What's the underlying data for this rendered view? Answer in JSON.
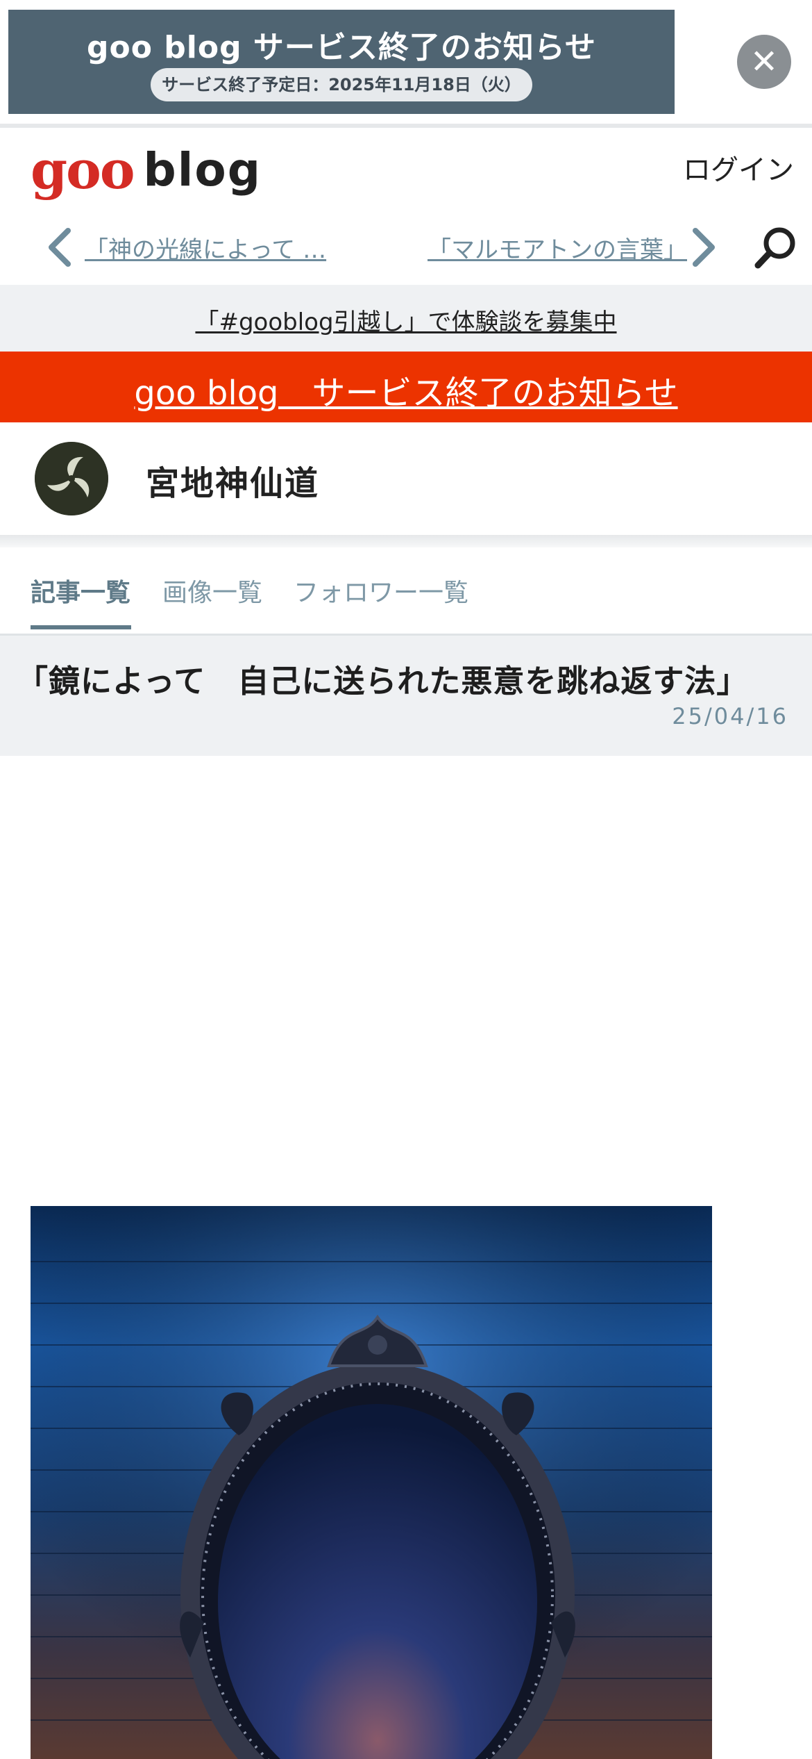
{
  "banner": {
    "title": "goo blog サービス終了のお知らせ",
    "date_pill": "サービス終了予定日：2025年11月18日（火）"
  },
  "close_icon": "close-icon",
  "header": {
    "logo_goo": "goo",
    "logo_blog": "blog",
    "login_label": "ログイン"
  },
  "article_nav": {
    "prev_label": "「神の光線によって …",
    "next_label": "「マルモアトンの言葉」"
  },
  "campaign": {
    "text": "「#gooblog引越し」で体験談を募集中"
  },
  "notice": {
    "text": "goo blog　サービス終了のお知らせ"
  },
  "blog": {
    "name": "宮地神仙道"
  },
  "tabs": [
    {
      "label": "記事一覧",
      "active": true
    },
    {
      "label": "画像一覧",
      "active": false
    },
    {
      "label": "フォロワー一覧",
      "active": false
    }
  ],
  "article": {
    "title": "「鏡によって　自己に送られた悪意を跳ね返す法」",
    "date": "25/04/16"
  },
  "colors": {
    "banner_bg": "#4f6472",
    "notice_red": "#ec3300",
    "logo_red": "#d42b24",
    "link_blue_gray": "#6f8c9c"
  }
}
